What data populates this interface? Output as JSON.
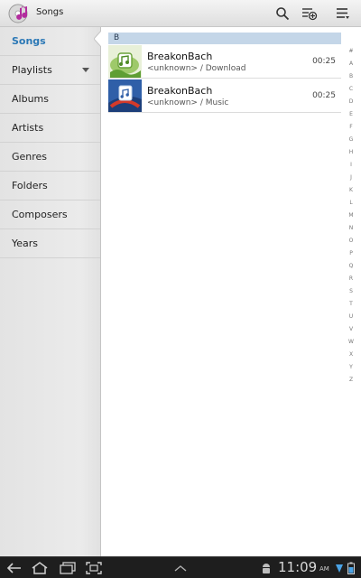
{
  "action_bar": {
    "title": "Songs",
    "icons": [
      "music-app-icon",
      "search-icon",
      "add-to-playlist-icon",
      "overflow-menu-icon"
    ]
  },
  "sidebar": {
    "items": [
      {
        "label": "Songs",
        "selected": true
      },
      {
        "label": "Playlists",
        "has_dropdown": true
      },
      {
        "label": "Albums"
      },
      {
        "label": "Artists"
      },
      {
        "label": "Genres"
      },
      {
        "label": "Folders"
      },
      {
        "label": "Composers"
      },
      {
        "label": "Years"
      }
    ]
  },
  "list": {
    "section_header": "B",
    "songs": [
      {
        "title": "BreakonBach",
        "subtitle": "<unknown> / Download",
        "duration": "00:25"
      },
      {
        "title": "BreakonBach",
        "subtitle": "<unknown> / Music",
        "duration": "00:25"
      }
    ]
  },
  "index_letters": [
    "#",
    "A",
    "B",
    "C",
    "D",
    "E",
    "F",
    "G",
    "H",
    "I",
    "J",
    "K",
    "L",
    "M",
    "N",
    "O",
    "P",
    "Q",
    "R",
    "S",
    "T",
    "U",
    "V",
    "W",
    "X",
    "Y",
    "Z"
  ],
  "system_bar": {
    "time": "11:09",
    "ampm": "AM"
  },
  "colors": {
    "accent": "#2b78b6",
    "section_header_bg": "#c4d6e8",
    "system_bar_bg": "#1e1e1e"
  }
}
